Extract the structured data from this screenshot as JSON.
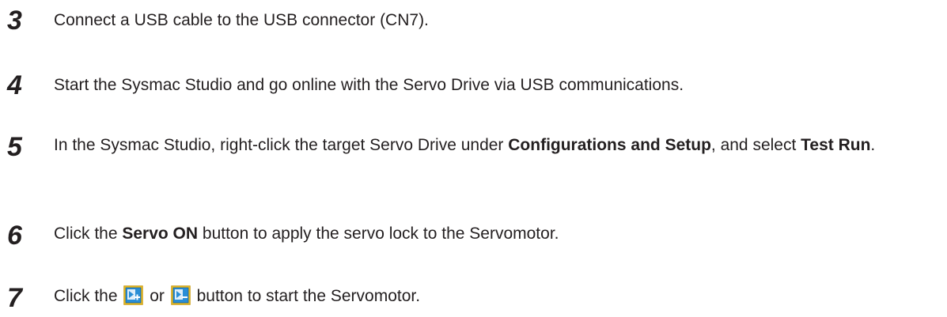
{
  "steps": [
    {
      "number": "3",
      "text": "Connect a USB cable to the USB connector (CN7)."
    },
    {
      "number": "4",
      "text": "Start the Sysmac Studio and go online with the Servo Drive via USB communications."
    },
    {
      "number": "5",
      "text_before": "In the Sysmac Studio, right-click the target Servo Drive under ",
      "bold_1": "Configurations and Setup",
      "text_middle": ", and select ",
      "bold_2": "Test Run",
      "text_after": "."
    },
    {
      "number": "6",
      "text_before": "Click the ",
      "bold_1": "Servo ON",
      "text_after": " button to apply the servo lock to the Servomotor."
    },
    {
      "number": "7",
      "text_before": "Click the",
      "text_or": "or",
      "text_after": "button to start the Servomotor.",
      "icon_1": "jog-forward-icon",
      "icon_2": "jog-reverse-icon"
    }
  ],
  "colors": {
    "text": "#231f20",
    "icon_border": "#f0c020",
    "icon_fill": "#2a8ed6"
  }
}
